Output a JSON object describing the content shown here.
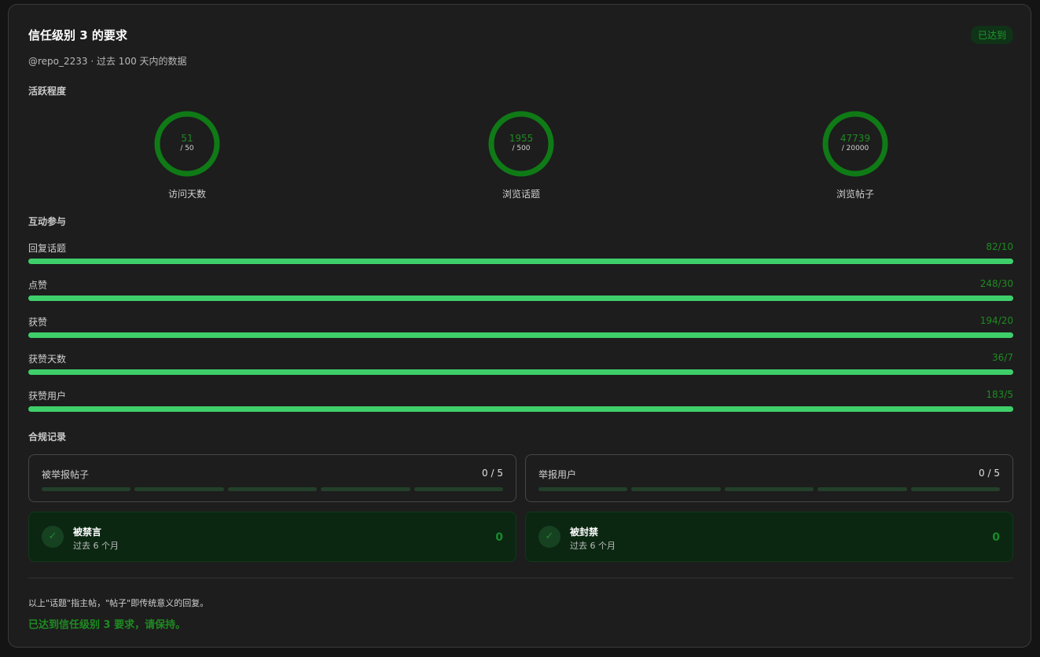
{
  "header": {
    "title": "信任级别 3 的要求",
    "badge": "已达到",
    "subtitle": "@repo_2233 · 过去 100 天内的数据"
  },
  "sections": {
    "activity": "活跃程度",
    "engagement": "互动参与",
    "compliance": "合规记录"
  },
  "activity": [
    {
      "value": "51",
      "target": "/ 50",
      "label": "访问天数",
      "progress": 1.0
    },
    {
      "value": "1955",
      "target": "/ 500",
      "label": "浏览话题",
      "progress": 1.0
    },
    {
      "value": "47739",
      "target": "/ 20000",
      "label": "浏览帖子",
      "progress": 1.0
    }
  ],
  "engagement": [
    {
      "label": "回复话题",
      "value": "82/10",
      "progress": 1.0
    },
    {
      "label": "点赞",
      "value": "248/30",
      "progress": 1.0
    },
    {
      "label": "获赞",
      "value": "194/20",
      "progress": 1.0
    },
    {
      "label": "获赞天数",
      "value": "36/7",
      "progress": 1.0
    },
    {
      "label": "获赞用户",
      "value": "183/5",
      "progress": 1.0
    }
  ],
  "compliance": {
    "reports": [
      {
        "label": "被举报帖子",
        "value": "0 / 5",
        "filled_segments": 0,
        "total_segments": 5
      },
      {
        "label": "举报用户",
        "value": "0 / 5",
        "filled_segments": 0,
        "total_segments": 5
      }
    ],
    "statuses": [
      {
        "title": "被禁言",
        "subtitle": "过去 6 个月",
        "count": "0",
        "icon": "check-icon"
      },
      {
        "title": "被封禁",
        "subtitle": "过去 6 个月",
        "count": "0",
        "icon": "check-icon"
      }
    ]
  },
  "footer": {
    "note": "以上\"话题\"指主帖，\"帖子\"即传统意义的回复。",
    "status": "已达到信任级别 3 要求，请保持。"
  },
  "colors": {
    "accent": "#1f8a22",
    "bar_fill": "#3ecf6a",
    "badge_bg": "#0f3317",
    "card_bg": "#1d1d1d"
  }
}
